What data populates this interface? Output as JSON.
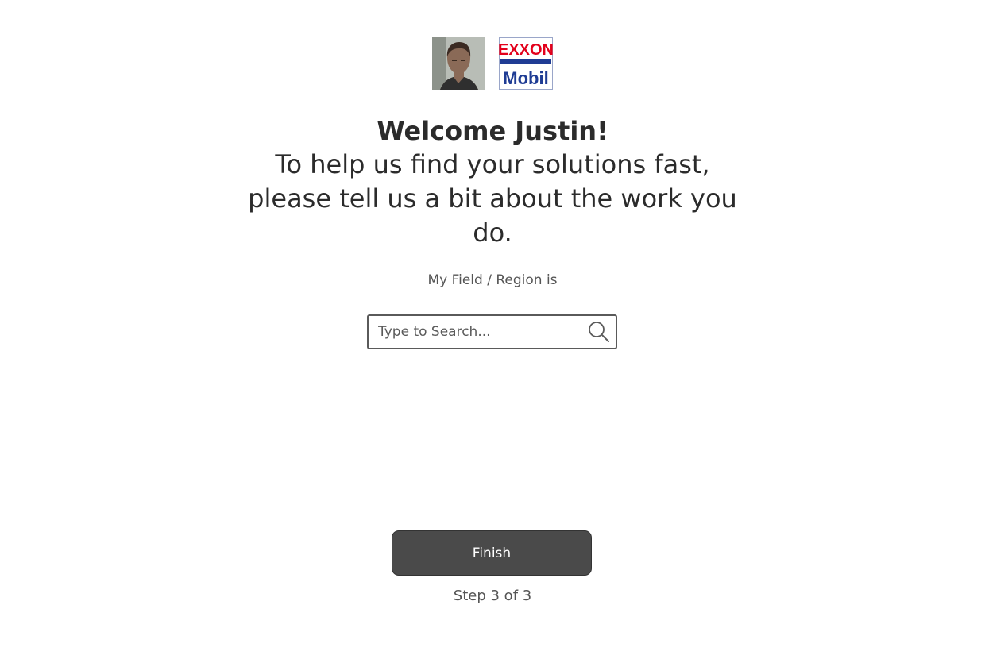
{
  "header": {
    "user_avatar_icon": "user-photo",
    "brand_logo_text_top": "EXXON",
    "brand_logo_text_bottom": "Mobil",
    "brand_colors": {
      "red": "#e3001b",
      "blue": "#1f3c94"
    }
  },
  "intro": {
    "welcome": "Welcome Justin!",
    "subtitle": "To help us find your solutions fast, please tell us a bit about the work you do."
  },
  "form": {
    "field_label": "My Field / Region is",
    "search_placeholder": "Type to Search...",
    "search_value": ""
  },
  "footer": {
    "finish_label": "Finish",
    "step_text": "Step 3 of 3"
  },
  "colors": {
    "button_bg": "#4a4a4a",
    "text": "#2b2b2b"
  }
}
